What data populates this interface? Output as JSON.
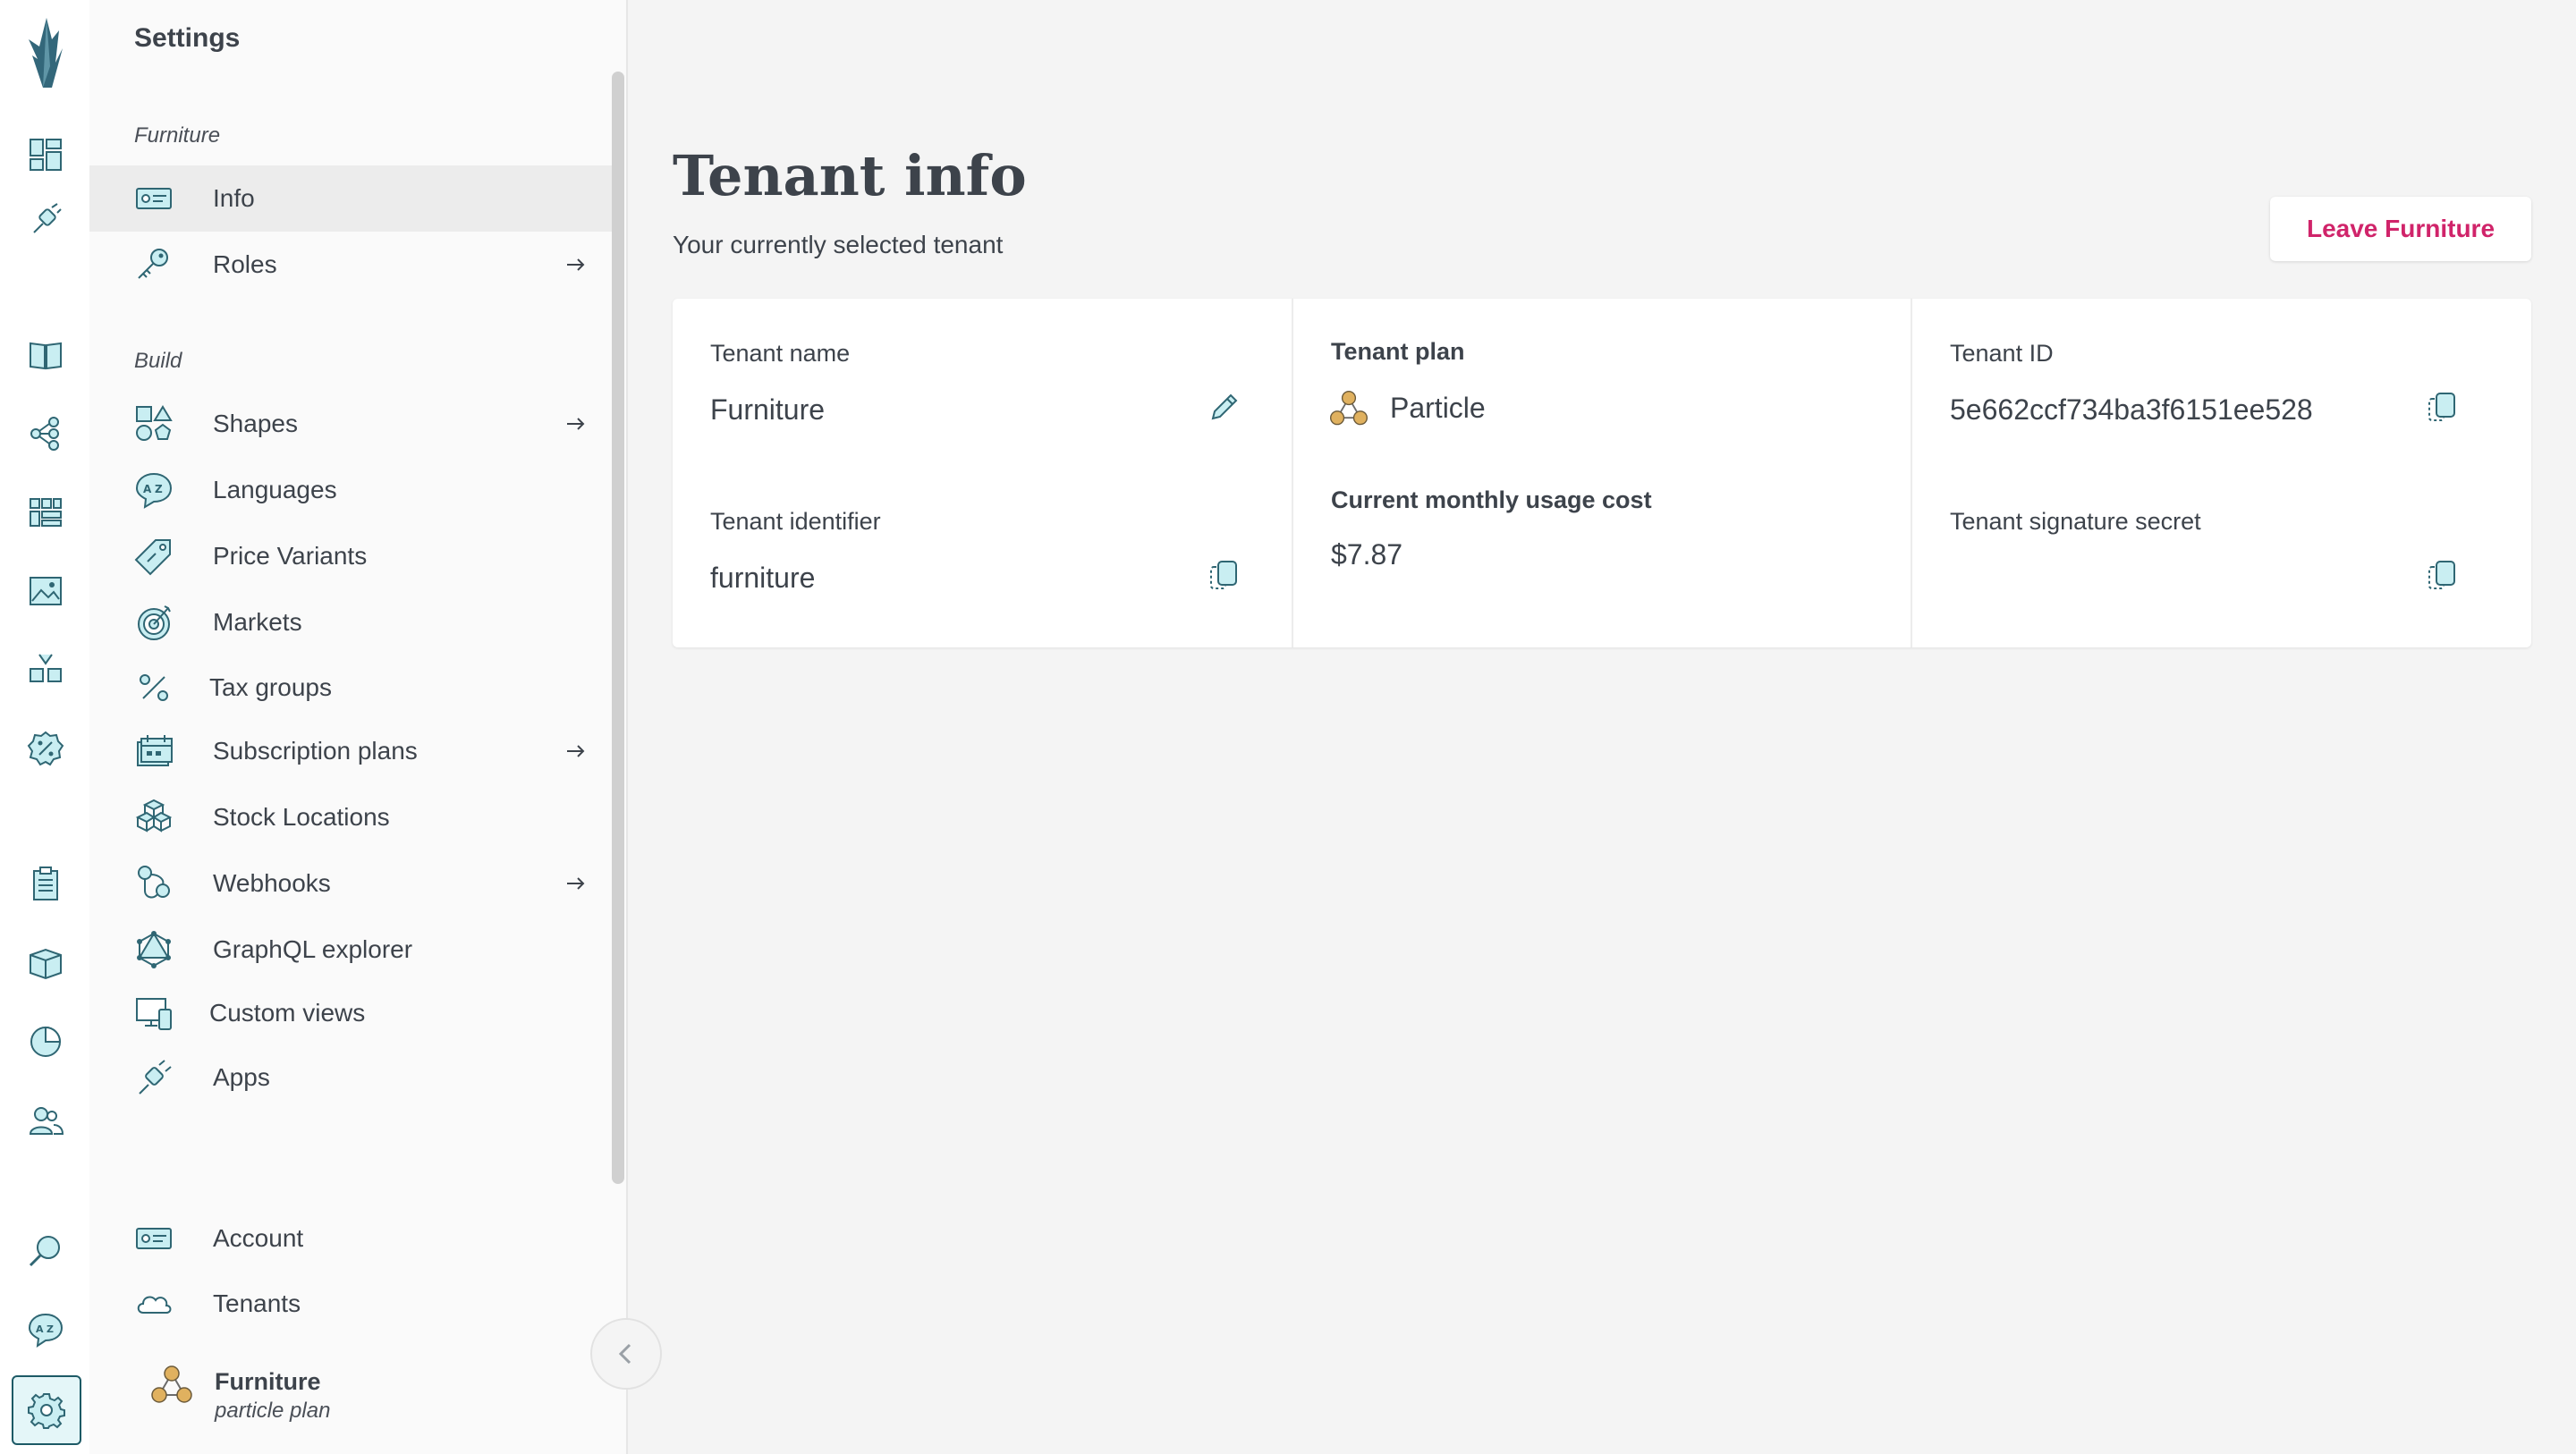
{
  "sidebar_rail": {
    "items": [
      {
        "icon": "dashboard-icon"
      },
      {
        "icon": "plug-icon"
      },
      {
        "icon": "catalogue-book-icon"
      },
      {
        "icon": "topics-tree-icon"
      },
      {
        "icon": "grids-icon"
      },
      {
        "icon": "media-image-icon"
      },
      {
        "icon": "bulk-shapes-icon"
      },
      {
        "icon": "discounts-percent-icon"
      },
      {
        "icon": "orders-clipboard-icon"
      },
      {
        "icon": "customers-box-icon"
      },
      {
        "icon": "usage-chart-icon"
      },
      {
        "icon": "users-icon"
      },
      {
        "icon": "search-icon"
      },
      {
        "icon": "translate-icon"
      },
      {
        "icon": "settings-gear-icon"
      }
    ]
  },
  "settings": {
    "title": "Settings",
    "group_tenant": "Furniture",
    "group_build": "Build",
    "items_tenant": [
      {
        "label": "Info",
        "icon": "id-card-icon"
      },
      {
        "label": "Roles",
        "icon": "key-icon"
      }
    ],
    "items_build": [
      {
        "label": "Shapes",
        "icon": "shapes-icon"
      },
      {
        "label": "Languages",
        "icon": "languages-icon"
      },
      {
        "label": "Price Variants",
        "icon": "price-tag-icon"
      },
      {
        "label": "Markets",
        "icon": "target-icon"
      },
      {
        "label": "Tax groups",
        "icon": "percent-icon"
      },
      {
        "label": "Subscription plans",
        "icon": "calendar-stack-icon"
      },
      {
        "label": "Stock Locations",
        "icon": "boxes-icon"
      },
      {
        "label": "Webhooks",
        "icon": "webhook-icon"
      },
      {
        "label": "GraphQL explorer",
        "icon": "graphql-icon"
      },
      {
        "label": "Custom views",
        "icon": "devices-icon"
      },
      {
        "label": "Apps",
        "icon": "plug-icon"
      }
    ],
    "items_bottom": [
      {
        "label": "Account",
        "icon": "id-card-icon"
      },
      {
        "label": "Tenants",
        "icon": "cloud-icon"
      }
    ],
    "current_tenant": {
      "name": "Furniture",
      "plan": "particle plan"
    }
  },
  "main": {
    "title": "Tenant info",
    "subtitle": "Your currently selected tenant",
    "leave_button": "Leave Furniture",
    "tenant_name_label": "Tenant name",
    "tenant_name": "Furniture",
    "tenant_identifier_label": "Tenant identifier",
    "tenant_identifier": "furniture",
    "tenant_plan_label": "Tenant plan",
    "tenant_plan": "Particle",
    "usage_cost_label": "Current monthly usage cost",
    "usage_cost": "$7.87",
    "tenant_id_label": "Tenant ID",
    "tenant_id": "5e662ccf734ba3f6151ee528",
    "signature_secret_label": "Tenant signature secret"
  },
  "colors": {
    "accent_teal": "#2a8d9c",
    "icon_fill": "#c9eef2",
    "leave_pink": "#d0246a",
    "particle_gold": "#e0b15f"
  }
}
